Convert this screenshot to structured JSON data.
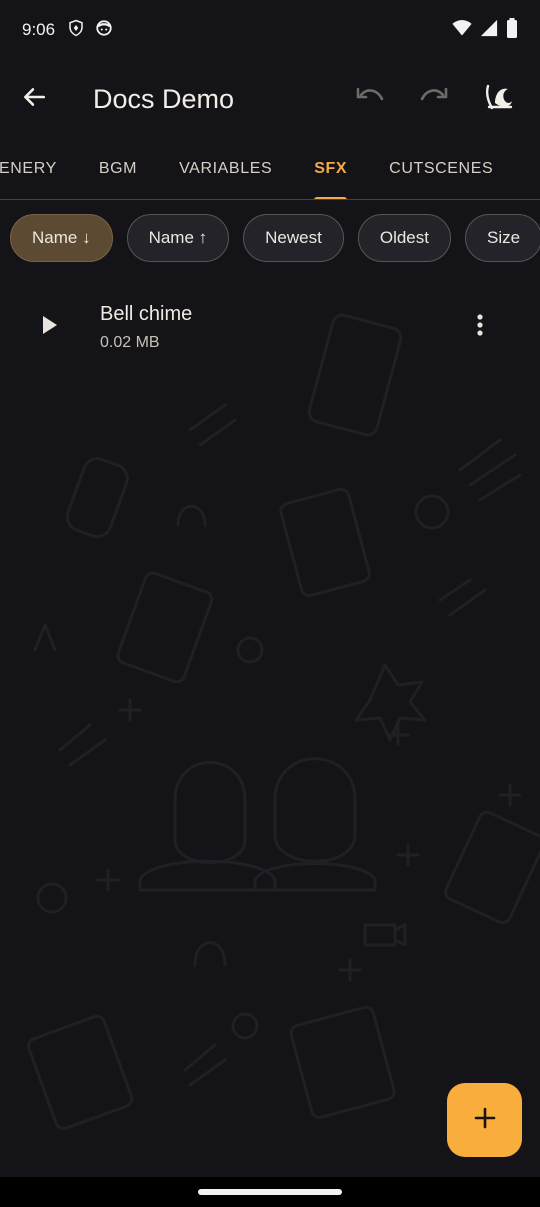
{
  "status_bar": {
    "time": "9:06",
    "left_icons": [
      "shield-icon",
      "face-icon"
    ],
    "right_icons": [
      "wifi-icon",
      "signal-icon",
      "battery-icon"
    ]
  },
  "app_bar": {
    "title": "Docs Demo",
    "icons": [
      "back-arrow-icon",
      "undo-icon",
      "redo-icon",
      "theme-icon"
    ]
  },
  "tabs": [
    {
      "label": "ENERY",
      "active": false
    },
    {
      "label": "BGM",
      "active": false
    },
    {
      "label": "VARIABLES",
      "active": false
    },
    {
      "label": "SFX",
      "active": true
    },
    {
      "label": "CUTSCENES",
      "active": false
    }
  ],
  "sort_chips": [
    {
      "label": "Name ↓",
      "selected": true
    },
    {
      "label": "Name ↑",
      "selected": false
    },
    {
      "label": "Newest",
      "selected": false
    },
    {
      "label": "Oldest",
      "selected": false
    },
    {
      "label": "Size",
      "selected": false
    }
  ],
  "sfx_items": [
    {
      "name": "Bell chime",
      "size": "0.02 MB"
    }
  ],
  "fab": {
    "icon": "plus-icon"
  },
  "colors": {
    "accent": "#f5a94a",
    "fab": "#f9ad3c",
    "background": "#141317",
    "chip_selected": "#5d4a33"
  }
}
